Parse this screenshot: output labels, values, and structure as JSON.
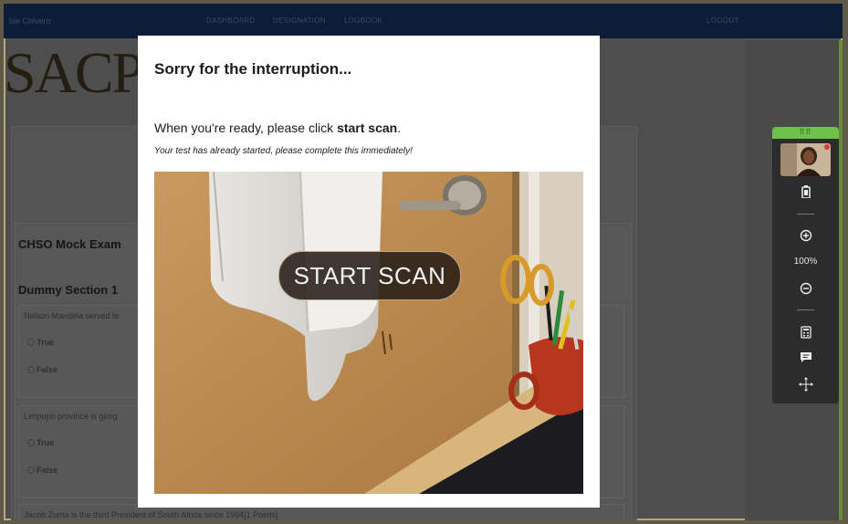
{
  "topnav": {
    "user_name": "ble Chivero",
    "links": [
      "DASHBOARD",
      "DESIGNATION",
      "LOGBOOK"
    ],
    "logout": "LOGOUT"
  },
  "logo_text": "SACP",
  "exam": {
    "title": "CHSO Mock Exam",
    "section": "Dummy Section 1",
    "questions": [
      {
        "text": "Nelson Mandela served te",
        "options": [
          "True",
          "False"
        ]
      },
      {
        "text": "Limpopo province is geog",
        "options": [
          "True",
          "False"
        ]
      },
      {
        "text": "Jacob Zuma is the third President of South Africa since 1994[1 Points]",
        "options": []
      }
    ]
  },
  "toolbar": {
    "zoom_level": "100%",
    "icons": [
      "battery-icon",
      "zoom-in-icon",
      "zoom-out-icon",
      "calculator-icon",
      "chat-icon",
      "move-icon"
    ],
    "accent_color": "#6cc24a"
  },
  "modal": {
    "heading": "Sorry for the interruption...",
    "instruction_prefix": "When you're ready, please click ",
    "instruction_bold": "start scan",
    "instruction_suffix": ".",
    "warning": "Your test has already started, please complete this immediately!",
    "start_scan_label": "START SCAN"
  }
}
